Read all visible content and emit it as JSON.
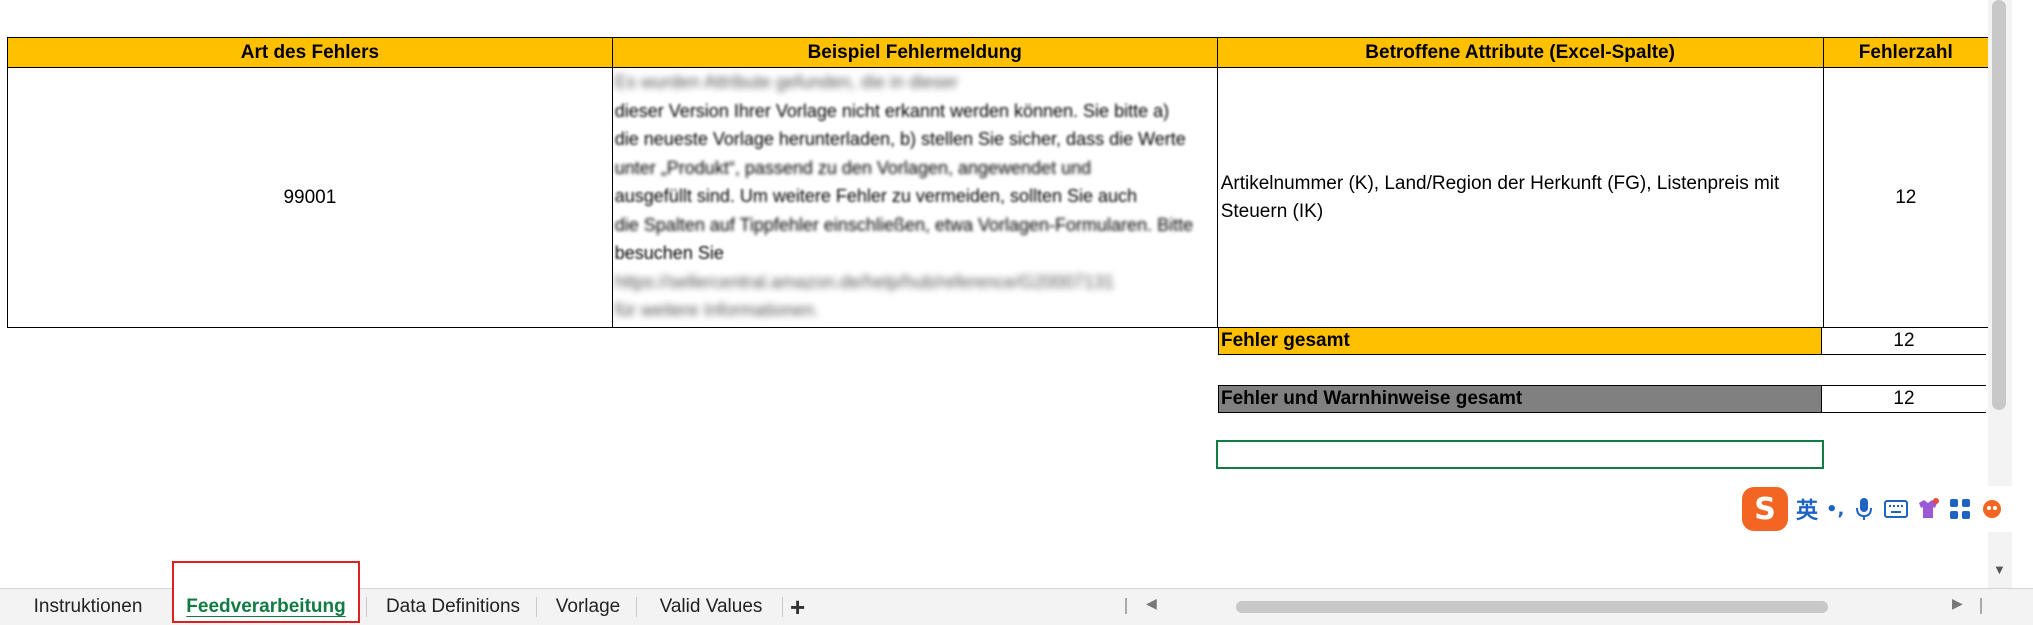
{
  "table": {
    "headers": [
      "Art des Fehlers",
      "Beispiel Fehlermeldung",
      "Betroffene Attribute (Excel-Spalte)",
      "Fehlerzahl"
    ],
    "row": {
      "art": "99001",
      "message_lines": [
        "Es wurden Attribute gefunden, die in dieser",
        "dieser Version Ihrer Vorlage nicht erkannt werden können. Sie bitte a)",
        "die neueste Vorlage herunterladen, b) stellen Sie sicher, dass die Werte",
        "unter „Produkt“, passend zu den Vorlagen, angewendet und",
        "ausgefüllt sind. Um weitere Fehler zu vermeiden, sollten Sie auch",
        "die Spalten auf Tippfehler einschließen, etwa Vorlagen-Formularen. Bitte",
        "besuchen Sie",
        "https://sellercentral.amazon.de/help/hub/reference/G20007131",
        "für weitere Informationen."
      ],
      "attributes": "Artikelnummer (K), Land/Region der Herkunft (FG), Listenpreis mit Steuern (IK)",
      "count": "12"
    }
  },
  "summary": {
    "errors_label": "Fehler gesamt",
    "errors_value": "12",
    "errors_bg": "#ffc000",
    "all_label": "Fehler und Warnhinweise gesamt",
    "all_value": "12",
    "all_bg": "#808080"
  },
  "ime": {
    "logo": "S",
    "mode": "英",
    "punct": "•,"
  },
  "tabs": {
    "items": [
      "Instruktionen",
      "Feedverarbeitung",
      "Data Definitions",
      "Vorlage",
      "Valid Values"
    ],
    "active": "Feedverarbeitung",
    "add": "+"
  },
  "colors": {
    "header": "#ffc000",
    "active_tab_text": "#107c41",
    "selection": "#107c41",
    "tab_highlight": "#e02020"
  }
}
